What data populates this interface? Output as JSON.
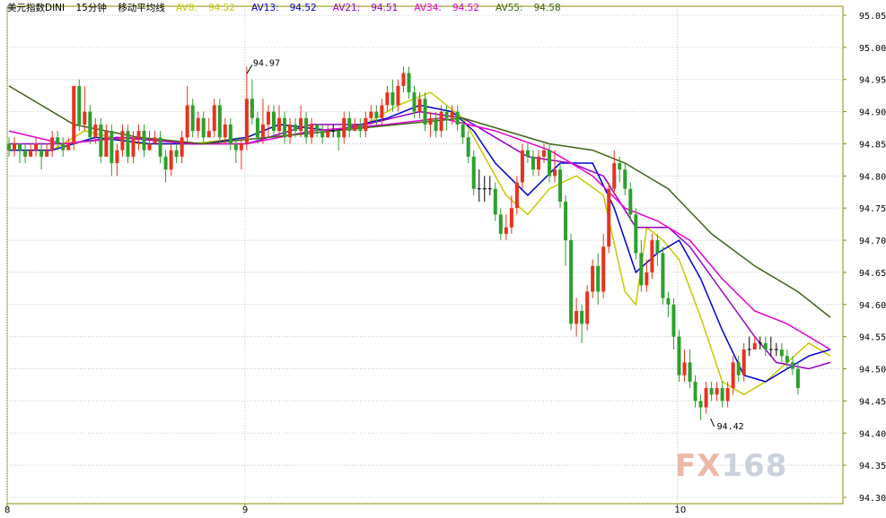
{
  "header": {
    "instrument": "美元指数DINI",
    "period": "15分钟",
    "indicator": "移动平均线"
  },
  "watermark": {
    "brand_fx": "FX",
    "brand_num": "168"
  },
  "colors": {
    "up_candle": "#e8321e",
    "down_candle": "#2ca02c",
    "doji": "#000000",
    "axis_frame": "#8c8c00",
    "grid": "#c8c8c8"
  },
  "chart_data": {
    "type": "candlestick",
    "ylim": [
      94.3,
      95.05
    ],
    "y_ticks": [
      "95.05",
      "95.00",
      "94.95",
      "94.90",
      "94.85",
      "94.80",
      "94.75",
      "94.70",
      "94.65",
      "94.60",
      "94.55",
      "94.50",
      "94.45",
      "94.40",
      "94.35",
      "94.30"
    ],
    "x_ticks": [
      {
        "label": "8",
        "index": 0
      },
      {
        "label": "9",
        "index": 44
      },
      {
        "label": "10",
        "index": 124
      }
    ],
    "annotations": [
      {
        "text": "94.97",
        "index": 44,
        "value": 94.97
      },
      {
        "text": "94.42",
        "index": 130,
        "value": 94.42
      }
    ],
    "moving_averages": [
      {
        "name": "AV8",
        "value": "94.52",
        "color": "#c8c800"
      },
      {
        "name": "AV13",
        "value": "94.52",
        "color": "#0000d2"
      },
      {
        "name": "AV21",
        "value": "94.51",
        "color": "#9600c8"
      },
      {
        "name": "AV34",
        "value": "94.52",
        "color": "#e600d2"
      },
      {
        "name": "AV55",
        "value": "94.58",
        "color": "#3c6414"
      }
    ],
    "ma_lines": [
      {
        "name": "AV8",
        "points": [
          [
            0,
            94.84
          ],
          [
            8,
            94.84
          ],
          [
            14,
            94.87
          ],
          [
            24,
            94.85
          ],
          [
            34,
            94.85
          ],
          [
            44,
            94.86
          ],
          [
            50,
            94.88
          ],
          [
            60,
            94.87
          ],
          [
            66,
            94.88
          ],
          [
            72,
            94.91
          ],
          [
            78,
            94.93
          ],
          [
            84,
            94.89
          ],
          [
            88,
            94.83
          ],
          [
            92,
            94.77
          ],
          [
            96,
            94.74
          ],
          [
            100,
            94.78
          ],
          [
            105,
            94.8
          ],
          [
            110,
            94.77
          ],
          [
            114,
            94.62
          ],
          [
            116,
            94.6
          ],
          [
            118,
            94.72
          ],
          [
            121,
            94.7
          ],
          [
            124,
            94.67
          ],
          [
            128,
            94.58
          ],
          [
            132,
            94.48
          ],
          [
            136,
            94.46
          ],
          [
            140,
            94.48
          ],
          [
            144,
            94.51
          ],
          [
            148,
            94.54
          ],
          [
            152,
            94.52
          ]
        ]
      },
      {
        "name": "AV13",
        "points": [
          [
            0,
            94.84
          ],
          [
            8,
            94.84
          ],
          [
            16,
            94.86
          ],
          [
            26,
            94.85
          ],
          [
            36,
            94.85
          ],
          [
            44,
            94.86
          ],
          [
            50,
            94.88
          ],
          [
            60,
            94.87
          ],
          [
            70,
            94.89
          ],
          [
            76,
            94.91
          ],
          [
            82,
            94.9
          ],
          [
            86,
            94.87
          ],
          [
            90,
            94.82
          ],
          [
            96,
            94.77
          ],
          [
            102,
            94.82
          ],
          [
            108,
            94.82
          ],
          [
            112,
            94.75
          ],
          [
            116,
            94.65
          ],
          [
            120,
            94.68
          ],
          [
            124,
            94.7
          ],
          [
            128,
            94.64
          ],
          [
            132,
            94.56
          ],
          [
            136,
            94.49
          ],
          [
            140,
            94.48
          ],
          [
            144,
            94.5
          ],
          [
            148,
            94.52
          ],
          [
            152,
            94.53
          ]
        ]
      },
      {
        "name": "AV21",
        "points": [
          [
            0,
            94.85
          ],
          [
            10,
            94.85
          ],
          [
            20,
            94.86
          ],
          [
            34,
            94.85
          ],
          [
            44,
            94.85
          ],
          [
            56,
            94.88
          ],
          [
            66,
            94.88
          ],
          [
            76,
            94.9
          ],
          [
            84,
            94.89
          ],
          [
            90,
            94.86
          ],
          [
            96,
            94.83
          ],
          [
            104,
            94.82
          ],
          [
            110,
            94.8
          ],
          [
            116,
            94.72
          ],
          [
            122,
            94.72
          ],
          [
            126,
            94.69
          ],
          [
            132,
            94.62
          ],
          [
            138,
            94.55
          ],
          [
            142,
            94.51
          ],
          [
            148,
            94.5
          ],
          [
            152,
            94.51
          ]
        ]
      },
      {
        "name": "AV34",
        "points": [
          [
            0,
            94.87
          ],
          [
            10,
            94.85
          ],
          [
            22,
            94.86
          ],
          [
            34,
            94.85
          ],
          [
            44,
            94.85
          ],
          [
            56,
            94.87
          ],
          [
            70,
            94.88
          ],
          [
            80,
            94.89
          ],
          [
            90,
            94.87
          ],
          [
            100,
            94.84
          ],
          [
            108,
            94.8
          ],
          [
            114,
            94.75
          ],
          [
            120,
            94.73
          ],
          [
            126,
            94.7
          ],
          [
            132,
            94.64
          ],
          [
            138,
            94.59
          ],
          [
            144,
            94.57
          ],
          [
            150,
            94.54
          ],
          [
            152,
            94.53
          ]
        ]
      },
      {
        "name": "AV55",
        "points": [
          [
            0,
            94.94
          ],
          [
            12,
            94.88
          ],
          [
            24,
            94.86
          ],
          [
            36,
            94.85
          ],
          [
            48,
            94.86
          ],
          [
            60,
            94.87
          ],
          [
            72,
            94.88
          ],
          [
            84,
            94.89
          ],
          [
            92,
            94.87
          ],
          [
            100,
            94.85
          ],
          [
            108,
            94.84
          ],
          [
            114,
            94.82
          ],
          [
            122,
            94.78
          ],
          [
            130,
            94.71
          ],
          [
            138,
            94.66
          ],
          [
            146,
            94.62
          ],
          [
            152,
            94.58
          ]
        ]
      }
    ],
    "candles": [
      [
        94.85,
        94.84,
        94.86,
        94.83
      ],
      [
        94.84,
        94.85,
        94.86,
        94.83
      ],
      [
        94.85,
        94.84,
        94.85,
        94.82
      ],
      [
        94.84,
        94.83,
        94.85,
        94.82
      ],
      [
        94.83,
        94.84,
        94.85,
        94.83
      ],
      [
        94.84,
        94.85,
        94.86,
        94.83
      ],
      [
        94.84,
        94.83,
        94.85,
        94.81
      ],
      [
        94.83,
        94.84,
        94.85,
        94.83
      ],
      [
        94.84,
        94.86,
        94.87,
        94.83
      ],
      [
        94.86,
        94.85,
        94.87,
        94.84
      ],
      [
        94.85,
        94.84,
        94.86,
        94.83
      ],
      [
        94.84,
        94.85,
        94.86,
        94.84
      ],
      [
        94.85,
        94.94,
        94.94,
        94.84
      ],
      [
        94.94,
        94.88,
        94.95,
        94.87
      ],
      [
        94.88,
        94.9,
        94.94,
        94.87
      ],
      [
        94.9,
        94.86,
        94.91,
        94.85
      ],
      [
        94.86,
        94.88,
        94.89,
        94.85
      ],
      [
        94.88,
        94.83,
        94.89,
        94.82
      ],
      [
        94.83,
        94.87,
        94.88,
        94.83
      ],
      [
        94.87,
        94.82,
        94.88,
        94.8
      ],
      [
        94.82,
        94.84,
        94.85,
        94.8
      ],
      [
        94.84,
        94.87,
        94.88,
        94.83
      ],
      [
        94.87,
        94.83,
        94.88,
        94.82
      ],
      [
        94.83,
        94.86,
        94.87,
        94.82
      ],
      [
        94.86,
        94.87,
        94.88,
        94.84
      ],
      [
        94.87,
        94.84,
        94.88,
        94.83
      ],
      [
        94.84,
        94.85,
        94.87,
        94.84
      ],
      [
        94.85,
        94.86,
        94.87,
        94.85
      ],
      [
        94.86,
        94.83,
        94.87,
        94.82
      ],
      [
        94.83,
        94.81,
        94.84,
        94.79
      ],
      [
        94.81,
        94.84,
        94.85,
        94.8
      ],
      [
        94.84,
        94.83,
        94.85,
        94.82
      ],
      [
        94.83,
        94.86,
        94.87,
        94.82
      ],
      [
        94.86,
        94.91,
        94.94,
        94.85
      ],
      [
        94.91,
        94.87,
        94.92,
        94.86
      ],
      [
        94.87,
        94.89,
        94.9,
        94.86
      ],
      [
        94.89,
        94.86,
        94.9,
        94.85
      ],
      [
        94.86,
        94.87,
        94.89,
        94.86
      ],
      [
        94.87,
        94.91,
        94.92,
        94.86
      ],
      [
        94.91,
        94.86,
        94.92,
        94.85
      ],
      [
        94.86,
        94.88,
        94.89,
        94.85
      ],
      [
        94.88,
        94.85,
        94.89,
        94.84
      ],
      [
        94.85,
        94.84,
        94.86,
        94.82
      ],
      [
        94.84,
        94.85,
        94.86,
        94.81
      ],
      [
        94.85,
        94.92,
        94.97,
        94.84
      ],
      [
        94.92,
        94.89,
        94.95,
        94.88
      ],
      [
        94.89,
        94.86,
        94.9,
        94.85
      ],
      [
        94.86,
        94.88,
        94.92,
        94.85
      ],
      [
        94.88,
        94.9,
        94.91,
        94.86
      ],
      [
        94.9,
        94.87,
        94.91,
        94.86
      ],
      [
        94.87,
        94.89,
        94.91,
        94.86
      ],
      [
        94.89,
        94.86,
        94.9,
        94.85
      ],
      [
        94.86,
        94.88,
        94.89,
        94.85
      ],
      [
        94.88,
        94.87,
        94.89,
        94.86
      ],
      [
        94.87,
        94.89,
        94.91,
        94.86
      ],
      [
        94.89,
        94.86,
        94.9,
        94.85
      ],
      [
        94.86,
        94.88,
        94.89,
        94.85
      ],
      [
        94.88,
        94.87,
        94.88,
        94.86
      ],
      [
        94.87,
        94.86,
        94.88,
        94.85
      ],
      [
        94.86,
        94.87,
        94.88,
        94.86
      ],
      [
        94.87,
        94.87,
        94.88,
        94.86
      ],
      [
        94.87,
        94.86,
        94.87,
        94.84
      ],
      [
        94.86,
        94.89,
        94.9,
        94.85
      ],
      [
        94.89,
        94.87,
        94.9,
        94.86
      ],
      [
        94.87,
        94.88,
        94.89,
        94.87
      ],
      [
        94.88,
        94.87,
        94.89,
        94.86
      ],
      [
        94.87,
        94.89,
        94.9,
        94.86
      ],
      [
        94.89,
        94.9,
        94.91,
        94.88
      ],
      [
        94.9,
        94.89,
        94.91,
        94.88
      ],
      [
        94.89,
        94.91,
        94.92,
        94.88
      ],
      [
        94.91,
        94.93,
        94.94,
        94.9
      ],
      [
        94.93,
        94.91,
        94.95,
        94.9
      ],
      [
        94.91,
        94.94,
        94.95,
        94.9
      ],
      [
        94.94,
        94.96,
        94.97,
        94.93
      ],
      [
        94.96,
        94.93,
        94.97,
        94.92
      ],
      [
        94.93,
        94.9,
        94.94,
        94.89
      ],
      [
        94.9,
        94.92,
        94.93,
        94.89
      ],
      [
        94.92,
        94.88,
        94.93,
        94.87
      ],
      [
        94.88,
        94.89,
        94.9,
        94.86
      ],
      [
        94.89,
        94.87,
        94.9,
        94.86
      ],
      [
        94.87,
        94.9,
        94.91,
        94.86
      ],
      [
        94.9,
        94.89,
        94.91,
        94.87
      ],
      [
        94.89,
        94.9,
        94.91,
        94.88
      ],
      [
        94.9,
        94.88,
        94.91,
        94.87
      ],
      [
        94.88,
        94.86,
        94.89,
        94.85
      ],
      [
        94.86,
        94.83,
        94.87,
        94.82
      ],
      [
        94.83,
        94.78,
        94.84,
        94.77
      ],
      [
        94.78,
        94.78,
        94.81,
        94.76
      ],
      [
        94.78,
        94.78,
        94.8,
        94.76
      ],
      [
        94.78,
        94.78,
        94.8,
        94.77
      ],
      [
        94.78,
        94.74,
        94.79,
        94.73
      ],
      [
        94.74,
        94.71,
        94.75,
        94.7
      ],
      [
        94.71,
        94.72,
        94.74,
        94.7
      ],
      [
        94.72,
        94.75,
        94.77,
        94.71
      ],
      [
        94.75,
        94.79,
        94.8,
        94.74
      ],
      [
        94.79,
        94.84,
        94.85,
        94.78
      ],
      [
        94.84,
        94.83,
        94.85,
        94.82
      ],
      [
        94.83,
        94.81,
        94.84,
        94.8
      ],
      [
        94.81,
        94.83,
        94.84,
        94.8
      ],
      [
        94.83,
        94.84,
        94.85,
        94.82
      ],
      [
        94.84,
        94.8,
        94.85,
        94.79
      ],
      [
        94.8,
        94.81,
        94.84,
        94.79
      ],
      [
        94.81,
        94.76,
        94.82,
        94.75
      ],
      [
        94.76,
        94.7,
        94.77,
        94.66
      ],
      [
        94.7,
        94.57,
        94.71,
        94.56
      ],
      [
        94.57,
        94.59,
        94.61,
        94.55
      ],
      [
        94.59,
        94.57,
        94.6,
        94.54
      ],
      [
        94.57,
        94.62,
        94.63,
        94.56
      ],
      [
        94.62,
        94.66,
        94.67,
        94.61
      ],
      [
        94.66,
        94.62,
        94.68,
        94.6
      ],
      [
        94.62,
        94.69,
        94.71,
        94.61
      ],
      [
        94.69,
        94.78,
        94.79,
        94.68
      ],
      [
        94.78,
        94.82,
        94.84,
        94.77
      ],
      [
        94.82,
        94.81,
        94.83,
        94.79
      ],
      [
        94.81,
        94.78,
        94.82,
        94.77
      ],
      [
        94.78,
        94.74,
        94.79,
        94.73
      ],
      [
        94.74,
        94.68,
        94.75,
        94.67
      ],
      [
        94.68,
        94.63,
        94.7,
        94.62
      ],
      [
        94.63,
        94.65,
        94.67,
        94.62
      ],
      [
        94.65,
        94.7,
        94.71,
        94.64
      ],
      [
        94.7,
        94.68,
        94.71,
        94.66
      ],
      [
        94.68,
        94.61,
        94.69,
        94.6
      ],
      [
        94.61,
        94.6,
        94.62,
        94.58
      ],
      [
        94.6,
        94.55,
        94.61,
        94.53
      ],
      [
        94.55,
        94.49,
        94.56,
        94.48
      ],
      [
        94.49,
        94.51,
        94.53,
        94.48
      ],
      [
        94.51,
        94.48,
        94.53,
        94.47
      ],
      [
        94.48,
        94.45,
        94.49,
        94.44
      ],
      [
        94.45,
        94.44,
        94.46,
        94.42
      ],
      [
        94.44,
        94.47,
        94.48,
        94.43
      ],
      [
        94.47,
        94.46,
        94.48,
        94.45
      ],
      [
        94.46,
        94.47,
        94.48,
        94.45
      ],
      [
        94.47,
        94.45,
        94.48,
        94.44
      ],
      [
        94.45,
        94.47,
        94.48,
        94.44
      ],
      [
        94.47,
        94.51,
        94.52,
        94.46
      ],
      [
        94.51,
        94.49,
        94.52,
        94.48
      ],
      [
        94.49,
        94.53,
        94.54,
        94.48
      ],
      [
        94.53,
        94.53,
        94.55,
        94.52
      ],
      [
        94.53,
        94.54,
        94.55,
        94.53
      ],
      [
        94.54,
        94.54,
        94.55,
        94.53
      ],
      [
        94.54,
        94.53,
        94.55,
        94.52
      ],
      [
        94.53,
        94.53,
        94.55,
        94.52
      ],
      [
        94.53,
        94.53,
        94.54,
        94.52
      ],
      [
        94.53,
        94.52,
        94.54,
        94.51
      ],
      [
        94.52,
        94.51,
        94.53,
        94.5
      ],
      [
        94.51,
        94.5,
        94.52,
        94.49
      ],
      [
        94.5,
        94.47,
        94.51,
        94.46
      ]
    ]
  }
}
